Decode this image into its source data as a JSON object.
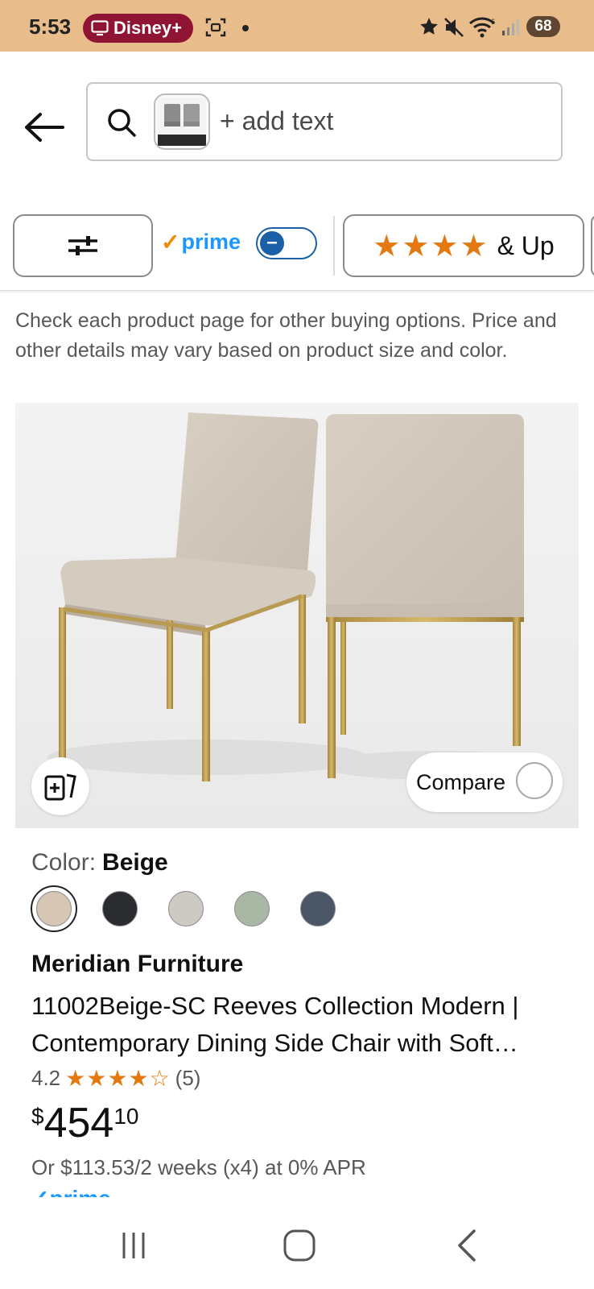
{
  "status_bar": {
    "time": "5:53",
    "disney_label": "Disney+",
    "battery": "68",
    "icons": [
      "screen-record-icon",
      "dot-icon",
      "star-icon",
      "mute-icon",
      "wifi-icon",
      "signal-icon"
    ]
  },
  "search": {
    "placeholder": "+ add text"
  },
  "filters": {
    "prime_label": "prime",
    "prime_check": "✓",
    "rating_stars": "★★★★",
    "rating_label": "& Up"
  },
  "notice": "Check each product page for other buying options. Price and other details may vary based on product size and color.",
  "product": {
    "compare_label": "Compare",
    "color_label": "Color:",
    "color_value": "Beige",
    "swatches": [
      "#d6c6b4",
      "#2b2c30",
      "#cdcac3",
      "#a9b8a4",
      "#4a5566"
    ],
    "brand": "Meridian Furniture",
    "title": "11002Beige-SC Reeves Collection Modern | Contemporary Dining Side Chair with Soft…",
    "rating_value": "4.2",
    "rating_stars": "★★★★☆",
    "rating_count": "(5)",
    "price_symbol": "$",
    "price_whole": "454",
    "price_fraction": "10",
    "installment": "Or $113.53/2 weeks (x4) at 0% APR",
    "prime_peek": "✓prime"
  },
  "colors": {
    "status_bg": "#e9bc8b",
    "disney_pill": "#8f1332",
    "prime_blue": "#1a98ff",
    "star_orange": "#e47911"
  }
}
